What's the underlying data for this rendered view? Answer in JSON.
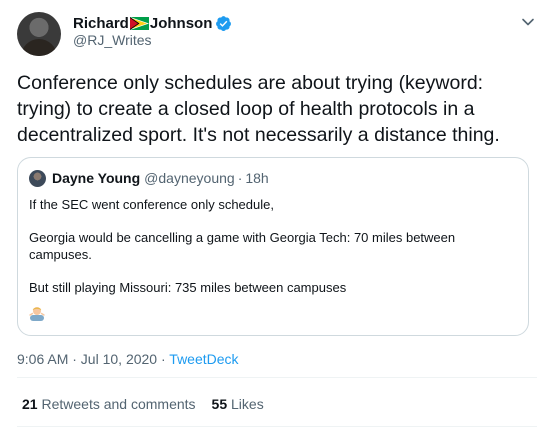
{
  "author": {
    "name_first": "Richard",
    "name_last": "Johnson",
    "flag_icon": "guyana-flag-icon",
    "verified_icon": "verified-badge-icon",
    "handle": "@RJ_Writes"
  },
  "tweet": {
    "text": "Conference only schedules are about trying (keyword: trying) to create a closed loop of health protocols in a decentralized sport. It's not necessarily a distance thing."
  },
  "quote": {
    "name": "Dayne Young",
    "handle": "@dayneyoung",
    "separator": "·",
    "time": "18h",
    "lines": [
      "If the SEC went conference only schedule,",
      "Georgia would be cancelling a game with Georgia Tech: 70 miles between campuses.",
      "But still playing Missouri: 735 miles between campuses"
    ],
    "emoji_icon": "person-shrugging-emoji"
  },
  "meta": {
    "timestamp": "9:06 AM · Jul 10, 2020",
    "separator": "·",
    "app": "TweetDeck"
  },
  "stats": {
    "retweets_count": "21",
    "retweets_label": "Retweets and comments",
    "likes_count": "55",
    "likes_label": "Likes"
  },
  "colors": {
    "link": "#1d9bf0",
    "muted": "#536471",
    "border": "#cfd9de"
  }
}
